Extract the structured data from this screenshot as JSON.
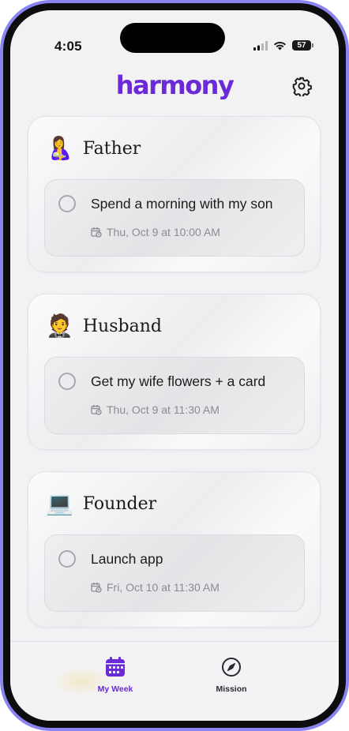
{
  "status_bar": {
    "time": "4:05",
    "battery": "57"
  },
  "header": {
    "logo": "harmony"
  },
  "cards": [
    {
      "emoji": "🤱",
      "role": "Father",
      "task": {
        "title": "Spend a morning with my son",
        "when": "Thu, Oct 9 at 10:00 AM"
      }
    },
    {
      "emoji": "🤵",
      "role": "Husband",
      "task": {
        "title": "Get my wife flowers + a card",
        "when": "Thu, Oct 9 at 11:30 AM"
      }
    },
    {
      "emoji": "💻",
      "role": "Founder",
      "task": {
        "title": "Launch app",
        "when": "Fri, Oct 10 at 11:30 AM"
      }
    }
  ],
  "tabbar": {
    "tabs": [
      {
        "label": "My Week",
        "icon": "calendar-icon",
        "active": true
      },
      {
        "label": "Mission",
        "icon": "compass-icon",
        "active": false
      }
    ]
  },
  "colors": {
    "brand": "#6a2ad8",
    "frame": "#8a85f0"
  }
}
